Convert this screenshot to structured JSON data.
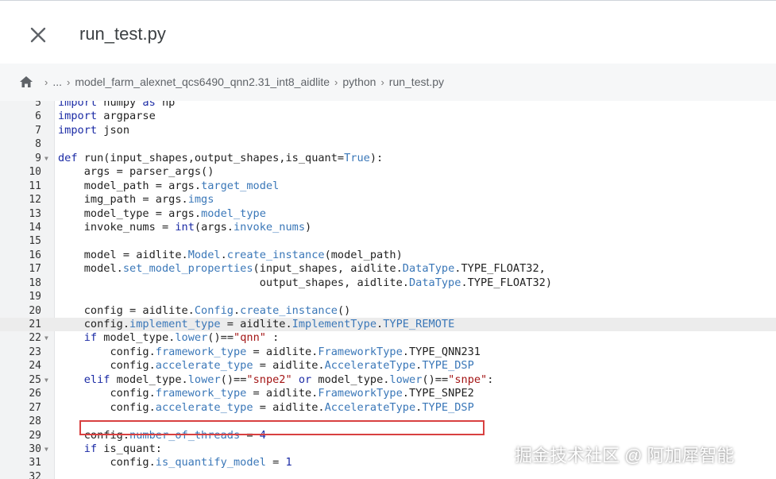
{
  "header": {
    "title": "run_test.py"
  },
  "breadcrumb": {
    "ellipsis": "...",
    "items": [
      "model_farm_alexnet_qcs6490_qnn2.31_int8_aidlite",
      "python",
      "run_test.py"
    ]
  },
  "editor": {
    "active_line": 21,
    "highlight_box_color": "#d84040",
    "lines": [
      {
        "n": "5",
        "fold": false,
        "code": [
          [
            "kw",
            "import"
          ],
          [
            "t",
            " numpy "
          ],
          [
            "kw",
            "as"
          ],
          [
            "t",
            " np"
          ]
        ]
      },
      {
        "n": "6",
        "fold": false,
        "code": [
          [
            "kw",
            "import"
          ],
          [
            "t",
            " argparse"
          ]
        ]
      },
      {
        "n": "7",
        "fold": false,
        "code": [
          [
            "kw",
            "import"
          ],
          [
            "t",
            " json"
          ]
        ]
      },
      {
        "n": "8",
        "fold": false,
        "code": []
      },
      {
        "n": "9",
        "fold": true,
        "code": [
          [
            "kw",
            "def"
          ],
          [
            "t",
            " run(input_shapes,output_shapes,is_quant="
          ],
          [
            "attr",
            "True"
          ],
          [
            "t",
            "):"
          ]
        ]
      },
      {
        "n": "10",
        "fold": false,
        "code": [
          [
            "t",
            "    args = parser_args()"
          ]
        ]
      },
      {
        "n": "11",
        "fold": false,
        "code": [
          [
            "t",
            "    model_path = args."
          ],
          [
            "attr",
            "target_model"
          ]
        ]
      },
      {
        "n": "12",
        "fold": false,
        "code": [
          [
            "t",
            "    img_path = args."
          ],
          [
            "attr",
            "imgs"
          ]
        ]
      },
      {
        "n": "13",
        "fold": false,
        "code": [
          [
            "t",
            "    model_type = args."
          ],
          [
            "attr",
            "model_type"
          ]
        ]
      },
      {
        "n": "14",
        "fold": false,
        "code": [
          [
            "t",
            "    invoke_nums = "
          ],
          [
            "kw",
            "int"
          ],
          [
            "t",
            "(args."
          ],
          [
            "attr",
            "invoke_nums"
          ],
          [
            "t",
            ")"
          ]
        ]
      },
      {
        "n": "15",
        "fold": false,
        "code": []
      },
      {
        "n": "16",
        "fold": false,
        "code": [
          [
            "t",
            "    model = aidlite."
          ],
          [
            "attr",
            "Model"
          ],
          [
            "t",
            "."
          ],
          [
            "attr",
            "create_instance"
          ],
          [
            "t",
            "(model_path)"
          ]
        ]
      },
      {
        "n": "17",
        "fold": false,
        "code": [
          [
            "t",
            "    model."
          ],
          [
            "attr",
            "set_model_properties"
          ],
          [
            "t",
            "(input_shapes, aidlite."
          ],
          [
            "attr",
            "DataType"
          ],
          [
            "t",
            ".TYPE_FLOAT32,"
          ]
        ]
      },
      {
        "n": "18",
        "fold": false,
        "code": [
          [
            "t",
            "                               output_shapes, aidlite."
          ],
          [
            "attr",
            "DataType"
          ],
          [
            "t",
            ".TYPE_FLOAT32)"
          ]
        ]
      },
      {
        "n": "19",
        "fold": false,
        "code": []
      },
      {
        "n": "20",
        "fold": false,
        "code": [
          [
            "t",
            "    config = aidlite."
          ],
          [
            "attr",
            "Config"
          ],
          [
            "t",
            "."
          ],
          [
            "attr",
            "create_instance"
          ],
          [
            "t",
            "()"
          ]
        ]
      },
      {
        "n": "21",
        "fold": false,
        "code": [
          [
            "t",
            "    config."
          ],
          [
            "attr",
            "implement_type"
          ],
          [
            "t",
            " = aidlite."
          ],
          [
            "attr",
            "ImplementType"
          ],
          [
            "t",
            "."
          ],
          [
            "attr",
            "TYPE_REMOTE"
          ]
        ]
      },
      {
        "n": "22",
        "fold": true,
        "code": [
          [
            "t",
            "    "
          ],
          [
            "kw",
            "if"
          ],
          [
            "t",
            " model_type."
          ],
          [
            "attr",
            "lower"
          ],
          [
            "t",
            "()=="
          ],
          [
            "str",
            "\"qnn\""
          ],
          [
            "t",
            " :"
          ]
        ]
      },
      {
        "n": "23",
        "fold": false,
        "code": [
          [
            "t",
            "        config."
          ],
          [
            "attr",
            "framework_type"
          ],
          [
            "t",
            " = aidlite."
          ],
          [
            "attr",
            "FrameworkType"
          ],
          [
            "t",
            ".TYPE_QNN231"
          ]
        ]
      },
      {
        "n": "24",
        "fold": false,
        "code": [
          [
            "t",
            "        config."
          ],
          [
            "attr",
            "accelerate_type"
          ],
          [
            "t",
            " = aidlite."
          ],
          [
            "attr",
            "AccelerateType"
          ],
          [
            "t",
            "."
          ],
          [
            "attr",
            "TYPE_DSP"
          ]
        ]
      },
      {
        "n": "25",
        "fold": true,
        "code": [
          [
            "t",
            "    "
          ],
          [
            "kw",
            "elif"
          ],
          [
            "t",
            " model_type."
          ],
          [
            "attr",
            "lower"
          ],
          [
            "t",
            "()=="
          ],
          [
            "str",
            "\"snpe2\""
          ],
          [
            "t",
            " "
          ],
          [
            "kw",
            "or"
          ],
          [
            "t",
            " model_type."
          ],
          [
            "attr",
            "lower"
          ],
          [
            "t",
            "()=="
          ],
          [
            "str",
            "\"snpe\""
          ],
          [
            "t",
            ":"
          ]
        ]
      },
      {
        "n": "26",
        "fold": false,
        "code": [
          [
            "t",
            "        config."
          ],
          [
            "attr",
            "framework_type"
          ],
          [
            "t",
            " = aidlite."
          ],
          [
            "attr",
            "FrameworkType"
          ],
          [
            "t",
            ".TYPE_SNPE2"
          ]
        ]
      },
      {
        "n": "27",
        "fold": false,
        "code": [
          [
            "t",
            "        config."
          ],
          [
            "attr",
            "accelerate_type"
          ],
          [
            "t",
            " = aidlite."
          ],
          [
            "attr",
            "AccelerateType"
          ],
          [
            "t",
            "."
          ],
          [
            "attr",
            "TYPE_DSP"
          ]
        ]
      },
      {
        "n": "28",
        "fold": false,
        "code": []
      },
      {
        "n": "29",
        "fold": false,
        "code": [
          [
            "t",
            "    config."
          ],
          [
            "attr",
            "number_of_threads"
          ],
          [
            "t",
            " = "
          ],
          [
            "kw",
            "4"
          ]
        ]
      },
      {
        "n": "30",
        "fold": true,
        "code": [
          [
            "t",
            "    "
          ],
          [
            "kw",
            "if"
          ],
          [
            "t",
            " is_quant:"
          ]
        ]
      },
      {
        "n": "31",
        "fold": false,
        "code": [
          [
            "t",
            "        config."
          ],
          [
            "attr",
            "is_quantify_model"
          ],
          [
            "t",
            " = "
          ],
          [
            "kw",
            "1"
          ]
        ]
      },
      {
        "n": "32",
        "fold": false,
        "code": []
      }
    ]
  },
  "watermark": "掘金技术社区 @ 阿加犀智能"
}
